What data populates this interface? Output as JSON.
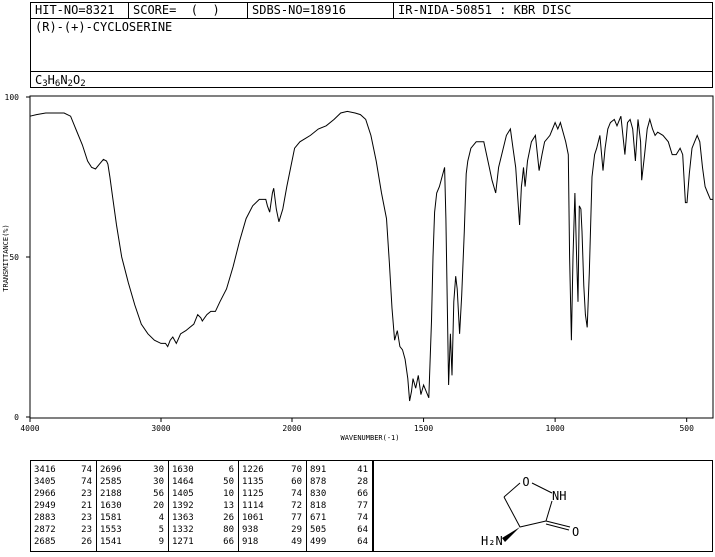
{
  "header": {
    "hit_no": "HIT-NO=8321",
    "score": "SCORE=  (  )",
    "sdbs_no": "SDBS-NO=18916",
    "ir_info": "IR-NIDA-50851 : KBR DISC",
    "compound_name": "(R)-(+)-CYCLOSERINE",
    "formula_parts": [
      [
        "C",
        "3"
      ],
      [
        "H",
        "6"
      ],
      [
        "N",
        "2"
      ],
      [
        "O",
        "2"
      ]
    ]
  },
  "chart_data": {
    "type": "line",
    "xlabel": "WAVENUMBER(-1)",
    "ylabel": "TRANSMITTANCE(%)",
    "xlim": [
      4000,
      400
    ],
    "ylim": [
      0,
      100
    ],
    "x_ticks": [
      4000,
      3000,
      2000,
      1500,
      1000,
      500
    ],
    "y_ticks": [
      0,
      50,
      100
    ],
    "series": [
      {
        "points": [
          [
            4000,
            94
          ],
          [
            3950,
            94.5
          ],
          [
            3880,
            95
          ],
          [
            3800,
            95
          ],
          [
            3740,
            95
          ],
          [
            3690,
            94
          ],
          [
            3650,
            90
          ],
          [
            3600,
            85
          ],
          [
            3560,
            80
          ],
          [
            3530,
            78
          ],
          [
            3500,
            77.5
          ],
          [
            3470,
            79
          ],
          [
            3440,
            80.5
          ],
          [
            3416,
            80
          ],
          [
            3405,
            79
          ],
          [
            3390,
            75
          ],
          [
            3370,
            69
          ],
          [
            3340,
            60
          ],
          [
            3300,
            50
          ],
          [
            3250,
            42
          ],
          [
            3200,
            35
          ],
          [
            3150,
            29
          ],
          [
            3100,
            26
          ],
          [
            3050,
            24
          ],
          [
            3000,
            23
          ],
          [
            2966,
            23
          ],
          [
            2949,
            22
          ],
          [
            2930,
            24
          ],
          [
            2910,
            25
          ],
          [
            2883,
            23
          ],
          [
            2872,
            24
          ],
          [
            2850,
            26
          ],
          [
            2810,
            27
          ],
          [
            2780,
            28
          ],
          [
            2750,
            29
          ],
          [
            2720,
            32
          ],
          [
            2696,
            31
          ],
          [
            2685,
            30
          ],
          [
            2650,
            32
          ],
          [
            2620,
            33
          ],
          [
            2585,
            33
          ],
          [
            2550,
            36
          ],
          [
            2500,
            40
          ],
          [
            2450,
            47
          ],
          [
            2400,
            55
          ],
          [
            2350,
            62
          ],
          [
            2300,
            66
          ],
          [
            2250,
            68
          ],
          [
            2200,
            68
          ],
          [
            2188,
            66
          ],
          [
            2170,
            64
          ],
          [
            2150,
            70
          ],
          [
            2140,
            71.5
          ],
          [
            2120,
            65
          ],
          [
            2100,
            61
          ],
          [
            2070,
            65
          ],
          [
            2040,
            72
          ],
          [
            2010,
            78
          ],
          [
            1990,
            84
          ],
          [
            1970,
            86
          ],
          [
            1950,
            87
          ],
          [
            1930,
            88
          ],
          [
            1900,
            90
          ],
          [
            1870,
            91
          ],
          [
            1840,
            93
          ],
          [
            1815,
            95
          ],
          [
            1790,
            95.5
          ],
          [
            1760,
            95
          ],
          [
            1740,
            94.5
          ],
          [
            1720,
            93
          ],
          [
            1700,
            88
          ],
          [
            1680,
            80
          ],
          [
            1660,
            70
          ],
          [
            1641,
            62
          ],
          [
            1630,
            48
          ],
          [
            1620,
            34
          ],
          [
            1610,
            24
          ],
          [
            1600,
            27
          ],
          [
            1590,
            22
          ],
          [
            1580,
            21
          ],
          [
            1570,
            18
          ],
          [
            1560,
            12
          ],
          [
            1553,
            5
          ],
          [
            1546,
            8
          ],
          [
            1540,
            12
          ],
          [
            1530,
            9
          ],
          [
            1520,
            13
          ],
          [
            1510,
            7
          ],
          [
            1500,
            10
          ],
          [
            1490,
            8
          ],
          [
            1480,
            6
          ],
          [
            1470,
            30
          ],
          [
            1464,
            50
          ],
          [
            1458,
            64
          ],
          [
            1450,
            70
          ],
          [
            1440,
            72
          ],
          [
            1430,
            75
          ],
          [
            1420,
            78
          ],
          [
            1415,
            62
          ],
          [
            1405,
            10
          ],
          [
            1398,
            26
          ],
          [
            1392,
            13
          ],
          [
            1385,
            36
          ],
          [
            1378,
            44
          ],
          [
            1372,
            40
          ],
          [
            1363,
            26
          ],
          [
            1355,
            38
          ],
          [
            1345,
            58
          ],
          [
            1338,
            76
          ],
          [
            1332,
            80
          ],
          [
            1320,
            84
          ],
          [
            1300,
            86
          ],
          [
            1271,
            86
          ],
          [
            1250,
            78
          ],
          [
            1240,
            74
          ],
          [
            1226,
            70
          ],
          [
            1215,
            78
          ],
          [
            1200,
            83
          ],
          [
            1185,
            88
          ],
          [
            1170,
            90
          ],
          [
            1160,
            84
          ],
          [
            1150,
            78
          ],
          [
            1135,
            60
          ],
          [
            1128,
            72
          ],
          [
            1125,
            74
          ],
          [
            1120,
            78
          ],
          [
            1114,
            72
          ],
          [
            1105,
            80
          ],
          [
            1090,
            86
          ],
          [
            1075,
            88
          ],
          [
            1061,
            77
          ],
          [
            1050,
            82
          ],
          [
            1040,
            86
          ],
          [
            1020,
            88
          ],
          [
            1010,
            90
          ],
          [
            1000,
            92
          ],
          [
            990,
            90
          ],
          [
            980,
            92
          ],
          [
            960,
            86
          ],
          [
            950,
            82
          ],
          [
            945,
            50
          ],
          [
            938,
            24
          ],
          [
            932,
            50
          ],
          [
            925,
            70
          ],
          [
            918,
            49
          ],
          [
            913,
            36
          ],
          [
            908,
            66
          ],
          [
            902,
            65
          ],
          [
            898,
            58
          ],
          [
            891,
            41
          ],
          [
            885,
            32
          ],
          [
            878,
            28
          ],
          [
            870,
            45
          ],
          [
            860,
            75
          ],
          [
            850,
            82
          ],
          [
            842,
            84
          ],
          [
            830,
            88
          ],
          [
            818,
            77
          ],
          [
            810,
            84
          ],
          [
            800,
            90
          ],
          [
            790,
            92
          ],
          [
            775,
            93
          ],
          [
            765,
            91
          ],
          [
            750,
            94
          ],
          [
            735,
            82
          ],
          [
            725,
            92
          ],
          [
            715,
            93
          ],
          [
            705,
            90
          ],
          [
            695,
            80
          ],
          [
            685,
            93
          ],
          [
            675,
            86
          ],
          [
            671,
            74
          ],
          [
            660,
            82
          ],
          [
            650,
            90
          ],
          [
            640,
            93
          ],
          [
            630,
            90
          ],
          [
            620,
            88
          ],
          [
            610,
            89
          ],
          [
            590,
            88
          ],
          [
            570,
            86
          ],
          [
            555,
            82
          ],
          [
            540,
            82
          ],
          [
            525,
            84
          ],
          [
            515,
            82
          ],
          [
            505,
            67
          ],
          [
            499,
            67
          ],
          [
            490,
            76
          ],
          [
            480,
            84
          ],
          [
            470,
            86
          ],
          [
            460,
            88
          ],
          [
            450,
            86
          ],
          [
            440,
            78
          ],
          [
            430,
            72
          ],
          [
            420,
            70
          ],
          [
            410,
            68
          ],
          [
            400,
            68
          ]
        ]
      }
    ]
  },
  "peak_table": [
    [
      [
        "3416",
        "74"
      ],
      [
        "3405",
        "74"
      ],
      [
        "2966",
        "23"
      ],
      [
        "2949",
        "21"
      ],
      [
        "2883",
        "23"
      ],
      [
        "2872",
        "23"
      ],
      [
        "2685",
        "26"
      ]
    ],
    [
      [
        "2696",
        "30"
      ],
      [
        "2585",
        "30"
      ],
      [
        "2188",
        "56"
      ],
      [
        "1630",
        "20"
      ],
      [
        "1581",
        "4"
      ],
      [
        "1553",
        "5"
      ],
      [
        "1541",
        "9"
      ]
    ],
    [
      [
        "1630",
        "6"
      ],
      [
        "1464",
        "50"
      ],
      [
        "1405",
        "10"
      ],
      [
        "1392",
        "13"
      ],
      [
        "1363",
        "26"
      ],
      [
        "1332",
        "80"
      ],
      [
        "1271",
        "66"
      ]
    ],
    [
      [
        "1226",
        "70"
      ],
      [
        "1135",
        "60"
      ],
      [
        "1125",
        "74"
      ],
      [
        "1114",
        "72"
      ],
      [
        "1061",
        "77"
      ],
      [
        "938",
        "29"
      ],
      [
        "918",
        "49"
      ]
    ],
    [
      [
        "891",
        "41"
      ],
      [
        "878",
        "28"
      ],
      [
        "830",
        "66"
      ],
      [
        "818",
        "77"
      ],
      [
        "671",
        "74"
      ],
      [
        "505",
        "64"
      ],
      [
        "499",
        "64"
      ]
    ]
  ],
  "structure": {
    "o_label": "O",
    "nh_label": "NH",
    "h2n_label": "H₂N",
    "carbonyl_o_label": "O"
  }
}
